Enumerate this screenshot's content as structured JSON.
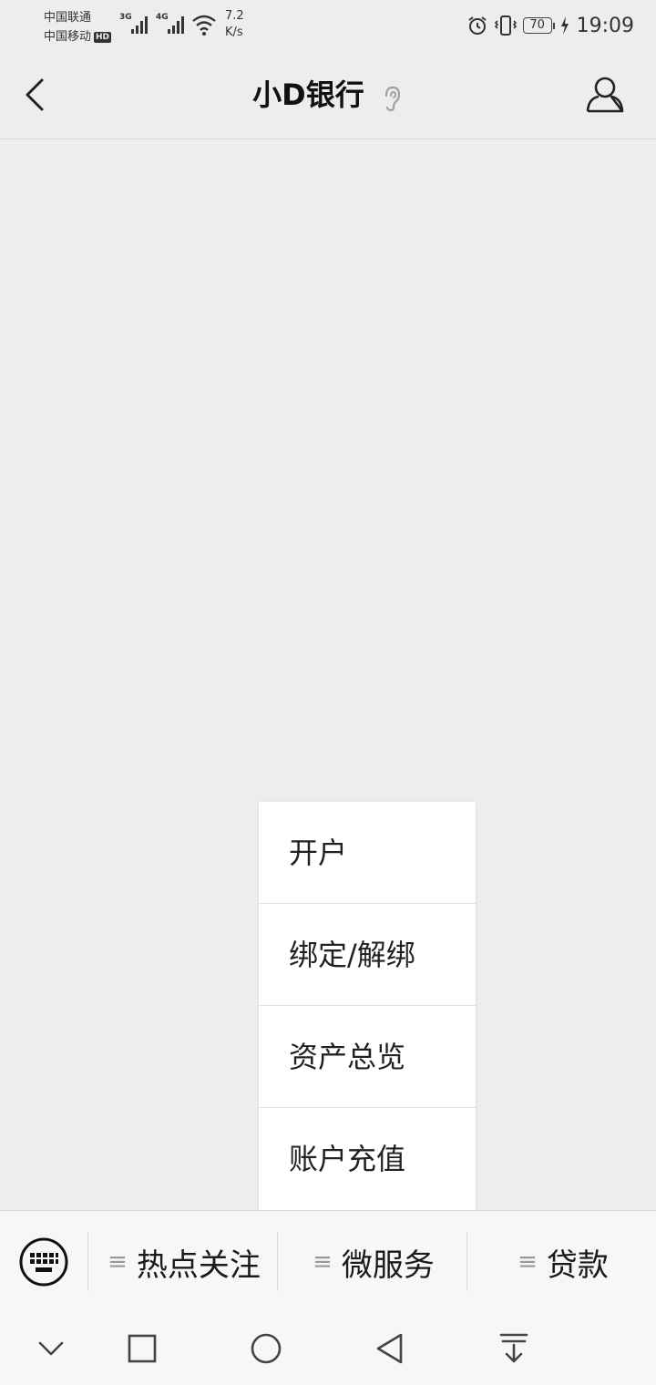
{
  "status_bar": {
    "carrier_1": "中国联通",
    "carrier_2": "中国移动",
    "hd_badge": "HD",
    "net_1": "3G",
    "net_2": "4G",
    "speed_value": "7.2",
    "speed_unit": "K/s",
    "battery": "70",
    "time": "19:09"
  },
  "header": {
    "title": "小D银行",
    "icons": {
      "back": "back-arrow-icon",
      "ear": "ear-icon",
      "profile": "profile-icon"
    }
  },
  "popup_menu": {
    "items": [
      "开户",
      "绑定/解绑",
      "资产总览",
      "账户充值"
    ]
  },
  "bottom_menu": {
    "keyboard_icon": "keyboard-icon",
    "tabs": [
      "热点关注",
      "微服务",
      "贷款"
    ]
  },
  "nav_bar": {
    "icons": [
      "collapse-icon",
      "recents-icon",
      "home-icon",
      "back-icon",
      "notification-icon"
    ]
  },
  "colors": {
    "background": "#ededed",
    "menu_bar": "#f7f7f7",
    "popup": "#ffffff"
  }
}
